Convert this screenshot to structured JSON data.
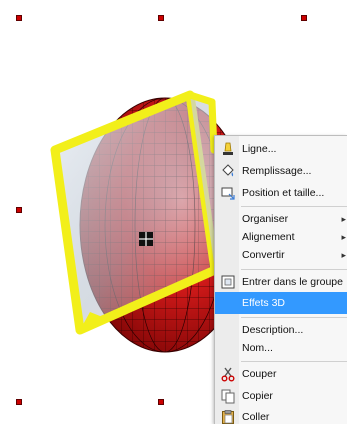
{
  "colors": {
    "sphere_red": "#d11a1a",
    "sphere_dark": "#7a0000",
    "frame_yellow": "#f2ef1a",
    "cube_face": "#c9d2dd",
    "handle_red": "#cc0000",
    "menu_highlight": "#3399ff"
  },
  "context_menu": {
    "items": [
      {
        "label": "Ligne...",
        "icon": "line-icon",
        "submenu": false,
        "highlighted": false
      },
      {
        "label": "Remplissage...",
        "icon": "fill-icon",
        "submenu": false,
        "highlighted": false
      },
      {
        "label": "Position et taille...",
        "icon": "position-size-icon",
        "submenu": false,
        "highlighted": false
      },
      {
        "label": "Organiser",
        "icon": "",
        "submenu": true,
        "highlighted": false
      },
      {
        "label": "Alignement",
        "icon": "",
        "submenu": true,
        "highlighted": false
      },
      {
        "label": "Convertir",
        "icon": "",
        "submenu": true,
        "highlighted": false
      },
      {
        "label": "Entrer dans le groupe",
        "icon": "enter-group-icon",
        "submenu": false,
        "highlighted": false
      },
      {
        "label": "Effets 3D",
        "icon": "",
        "submenu": false,
        "highlighted": true
      },
      {
        "label": "Description...",
        "icon": "",
        "submenu": false,
        "highlighted": false
      },
      {
        "label": "Nom...",
        "icon": "",
        "submenu": false,
        "highlighted": false
      },
      {
        "label": "Couper",
        "icon": "scissors-icon",
        "submenu": false,
        "highlighted": false
      },
      {
        "label": "Copier",
        "icon": "copy-icon",
        "submenu": false,
        "highlighted": false
      },
      {
        "label": "Coller",
        "icon": "paste-icon",
        "submenu": false,
        "highlighted": false
      }
    ]
  }
}
